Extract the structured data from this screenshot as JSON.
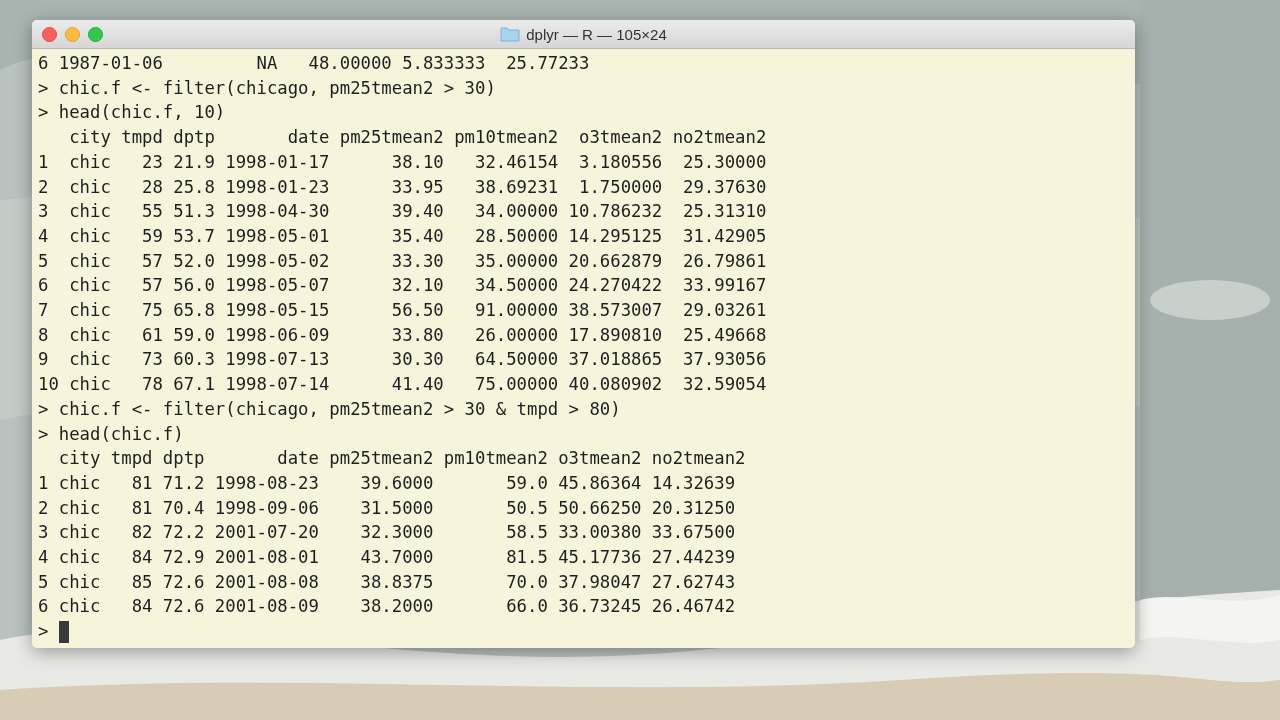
{
  "window": {
    "title": "dplyr — R — 105×24"
  },
  "terminal": {
    "lines": [
      "6 1987-01-06         NA   48.00000 5.833333  25.77233",
      "> chic.f <- filter(chicago, pm25tmean2 > 30)",
      "> head(chic.f, 10)",
      "   city tmpd dptp       date pm25tmean2 pm10tmean2  o3tmean2 no2tmean2",
      "1  chic   23 21.9 1998-01-17      38.10   32.46154  3.180556  25.30000",
      "2  chic   28 25.8 1998-01-23      33.95   38.69231  1.750000  29.37630",
      "3  chic   55 51.3 1998-04-30      39.40   34.00000 10.786232  25.31310",
      "4  chic   59 53.7 1998-05-01      35.40   28.50000 14.295125  31.42905",
      "5  chic   57 52.0 1998-05-02      33.30   35.00000 20.662879  26.79861",
      "6  chic   57 56.0 1998-05-07      32.10   34.50000 24.270422  33.99167",
      "7  chic   75 65.8 1998-05-15      56.50   91.00000 38.573007  29.03261",
      "8  chic   61 59.0 1998-06-09      33.80   26.00000 17.890810  25.49668",
      "9  chic   73 60.3 1998-07-13      30.30   64.50000 37.018865  37.93056",
      "10 chic   78 67.1 1998-07-14      41.40   75.00000 40.080902  32.59054",
      "> chic.f <- filter(chicago, pm25tmean2 > 30 & tmpd > 80)",
      "> head(chic.f)",
      "  city tmpd dptp       date pm25tmean2 pm10tmean2 o3tmean2 no2tmean2",
      "1 chic   81 71.2 1998-08-23    39.6000       59.0 45.86364 14.32639",
      "2 chic   81 70.4 1998-09-06    31.5000       50.5 50.66250 20.31250",
      "3 chic   82 72.2 2001-07-20    32.3000       58.5 33.00380 33.67500",
      "4 chic   84 72.9 2001-08-01    43.7000       81.5 45.17736 27.44239",
      "5 chic   85 72.6 2001-08-08    38.8375       70.0 37.98047 27.62743",
      "6 chic   84 72.6 2001-08-09    38.2000       66.0 36.73245 26.46742"
    ],
    "prompt": ">",
    "cursor": true
  }
}
